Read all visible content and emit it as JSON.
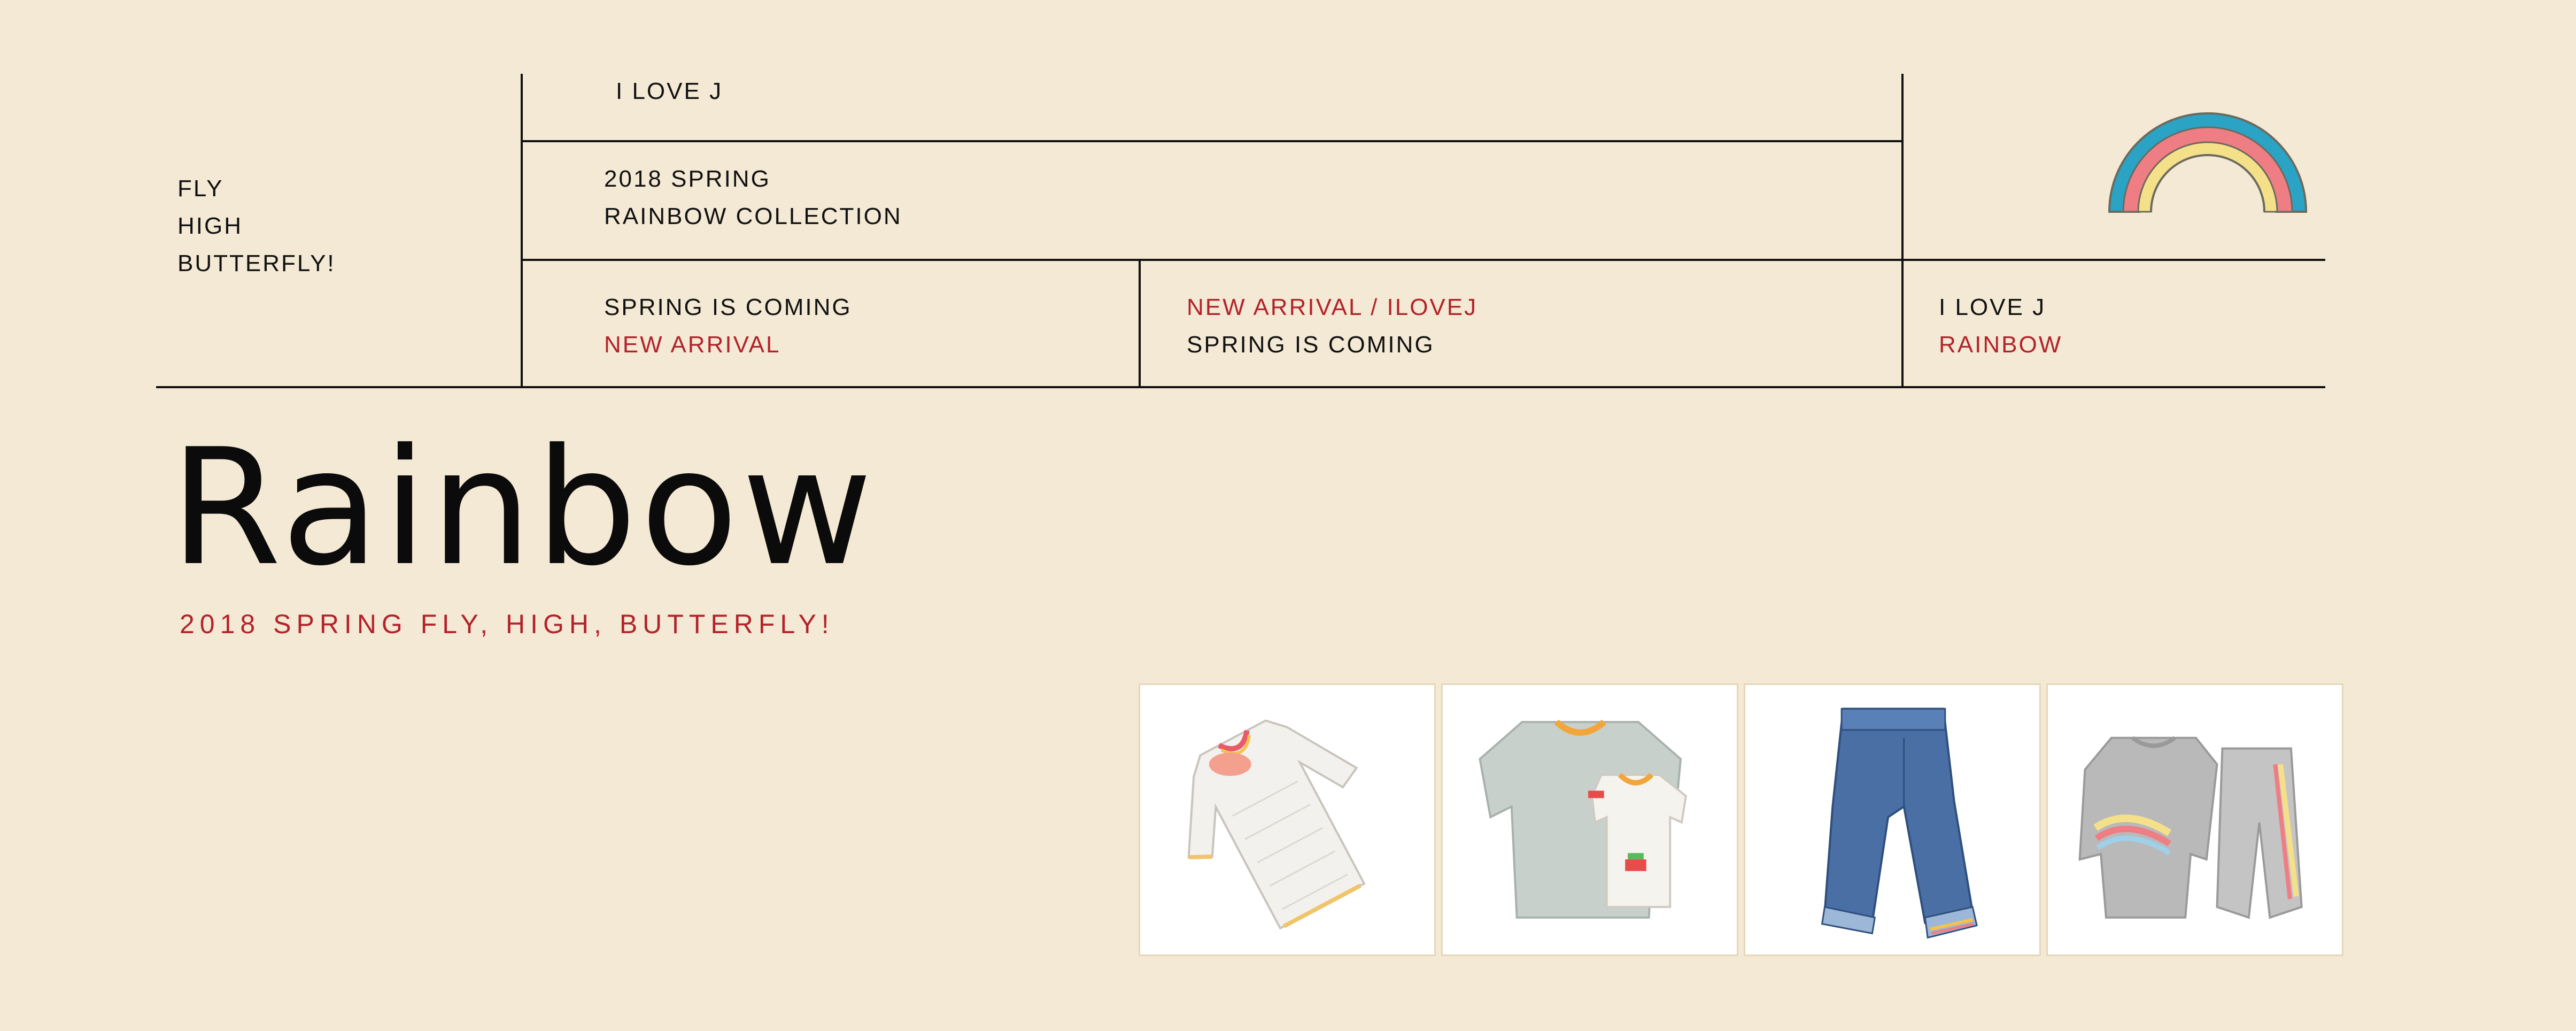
{
  "side": {
    "lines": [
      "FLY",
      "HIGH",
      "BUTTERFLY!"
    ]
  },
  "header": {
    "brand": "I LOVE J",
    "collection_line1": "2018 SPRING",
    "collection_line2": "RAINBOW COLLECTION"
  },
  "cells": [
    {
      "line1": "SPRING IS COMING",
      "line2": "NEW ARRIVAL"
    },
    {
      "line1": "NEW ARRIVAL / ILOVEJ",
      "line2": "SPRING IS COMING"
    },
    {
      "line1": "I LOVE J",
      "line2": "RAINBOW"
    }
  ],
  "hero": {
    "title": "Rainbow",
    "subtitle": "2018 SPRING FLY, HIGH, BUTTERFLY!"
  },
  "products": [
    {
      "icon": "white-quilted-coat-icon"
    },
    {
      "icon": "gray-tshirt-set-icon"
    },
    {
      "icon": "denim-jeans-icon"
    },
    {
      "icon": "rainbow-sweatsuit-icon"
    }
  ],
  "colors": {
    "background": "#f4e9d4",
    "accent_red": "#b3222b",
    "rainbow": [
      "#2aa3c5",
      "#ef7d84",
      "#f5e08a"
    ]
  }
}
